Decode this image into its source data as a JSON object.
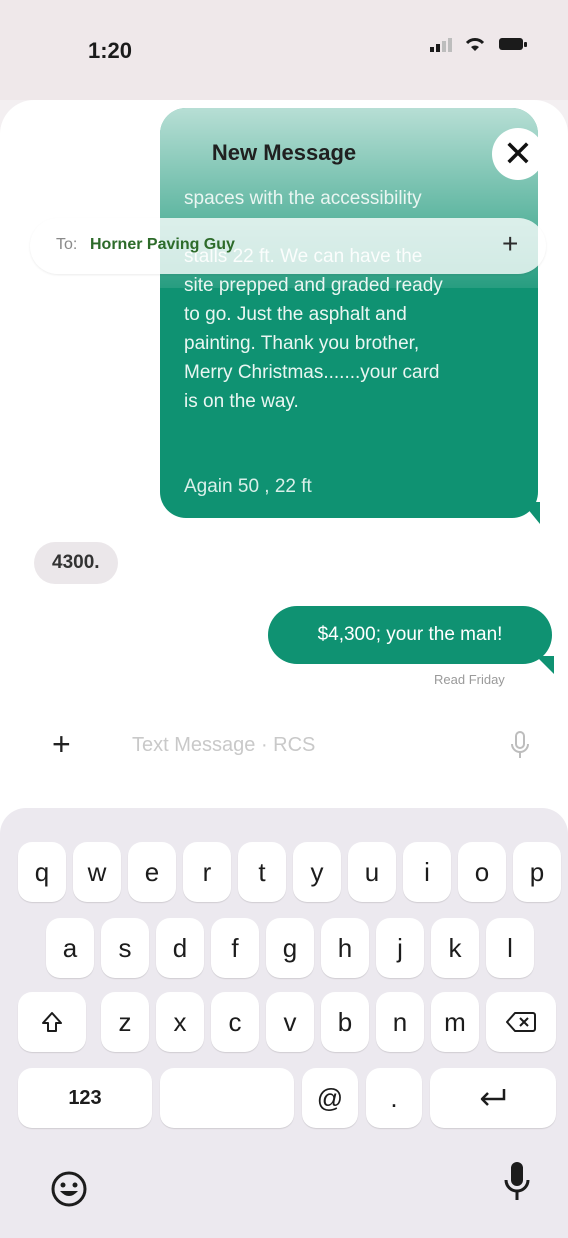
{
  "status_bar": {
    "time": "1:20"
  },
  "header": {
    "title": "New Message",
    "close_label": "✕"
  },
  "recipient": {
    "to_label": "To:",
    "name": "Horner Paving Guy",
    "add_label": "+"
  },
  "thread": {
    "bubble_text": "spaces with the accessibility\n\nstalls 22 ft. We can have the\nsite prepped and graded ready\nto go. Just the asphalt and\npainting. Thank you brother,\nMerry Christmas.......your card\nis on the way.",
    "bubble_footer": "Again 50 , 22 ft",
    "incoming": "4300.",
    "outgoing": "$4,300; your the man!",
    "read_receipt": "Read Friday"
  },
  "compose": {
    "placeholder": "Text Message · RCS",
    "plus": "+"
  },
  "keyboard": {
    "row1": [
      "q",
      "w",
      "e",
      "r",
      "t",
      "y",
      "u",
      "i",
      "o",
      "p"
    ],
    "row2": [
      "a",
      "s",
      "d",
      "f",
      "g",
      "h",
      "j",
      "k",
      "l"
    ],
    "row3": [
      "z",
      "x",
      "c",
      "v",
      "b",
      "n",
      "m"
    ],
    "numbers_key": "123",
    "at_key": "@",
    "period_key": "."
  },
  "colors": {
    "accent_green": "#0f9272",
    "keyboard_bg": "#ece9ef"
  }
}
